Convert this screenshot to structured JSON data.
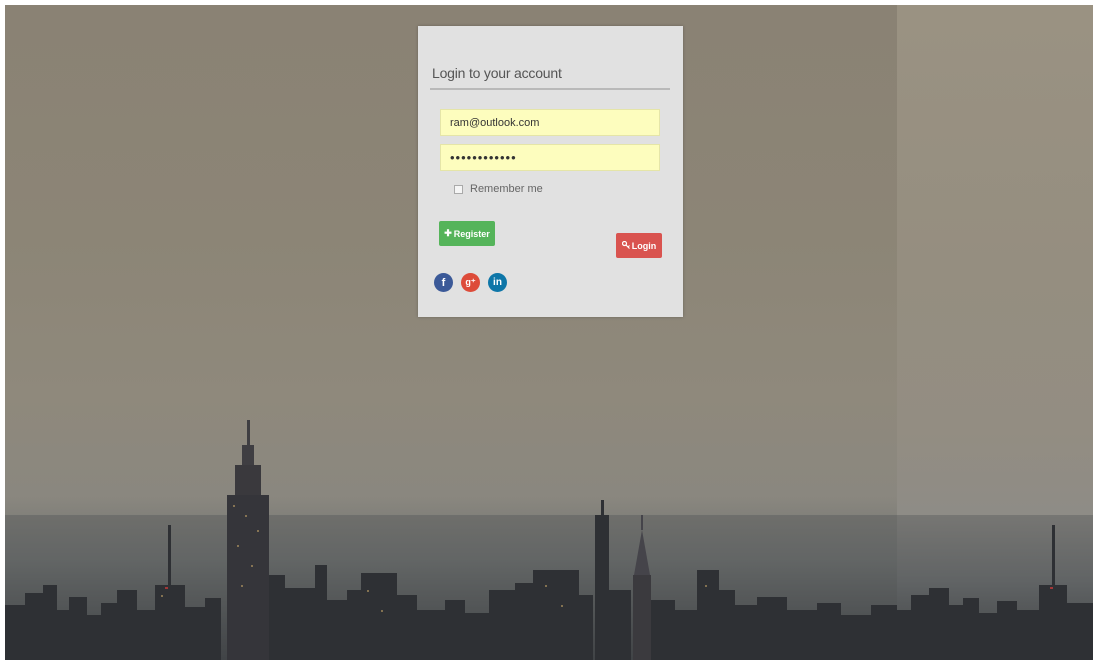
{
  "login": {
    "title": "Login to your account",
    "email_value": "ram@outlook.com",
    "password_value": "••••••••••••",
    "remember_label": "Remember me",
    "remember_checked": false,
    "register_label": "Register",
    "login_label": "Login"
  },
  "icons": {
    "register": "plus-icon",
    "login": "key-icon",
    "social": [
      "facebook-icon",
      "google-plus-icon",
      "linkedin-icon"
    ]
  },
  "colors": {
    "card_bg": "#e1e1e1",
    "field_bg": "#fdfdbe",
    "register_button": "#55b45a",
    "login_button": "#d9534f",
    "facebook": "#3b5998",
    "google_plus": "#dd4b39",
    "linkedin": "#0e76a8"
  }
}
